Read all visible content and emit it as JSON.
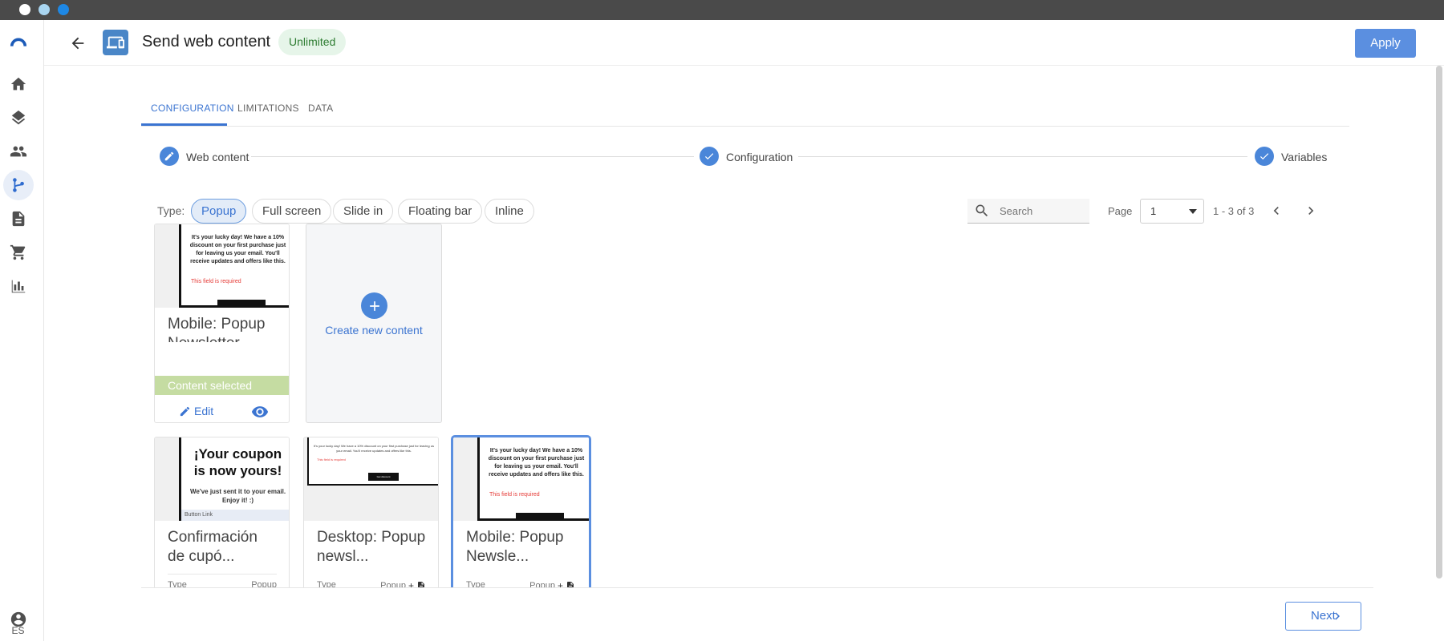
{
  "header": {
    "title": "Send web content",
    "badge": "Unlimited",
    "apply_label": "Apply"
  },
  "rail": {
    "items": [
      "logo-icon",
      "home-icon",
      "layers-icon",
      "people-icon",
      "flow-icon",
      "document-icon",
      "cart-icon",
      "bar-chart-icon"
    ],
    "active": "flow-icon",
    "language": "ES"
  },
  "tabs": [
    {
      "label": "CONFIGURATION",
      "active": true
    },
    {
      "label": "LIMITATIONS",
      "active": false
    },
    {
      "label": "DATA",
      "active": false
    }
  ],
  "stepper": [
    {
      "label": "Web content",
      "icon": "pencil-icon"
    },
    {
      "label": "Configuration",
      "icon": "check-icon"
    },
    {
      "label": "Variables",
      "icon": "check-icon"
    }
  ],
  "filters": {
    "type_label": "Type:",
    "chips": [
      "Popup",
      "Full screen",
      "Slide in",
      "Floating bar",
      "Inline"
    ],
    "active_chip": "Popup",
    "search_placeholder": "Search",
    "page_label": "Page",
    "page_value": "1",
    "range": "1 - 3 of 3"
  },
  "selected_card": {
    "title_line1": "Mobile: Popup",
    "title_line2": "Newsletter",
    "status": "Content selected",
    "edit_label": "Edit",
    "preview_text": "It's your lucky day! We have a 10% discount on your first purchase just for leaving us your email. You'll receive updates and offers like this.",
    "error_text": "This field is required"
  },
  "create_card": {
    "label": "Create new content"
  },
  "cards": [
    {
      "title_line1": "Confirmación",
      "title_line2": "de cupó...",
      "type_label": "Type",
      "type_value": "Popup",
      "preview_title": "¡Your coupon is now yours!",
      "preview_sub": "We've just sent it to your email. Enjoy it! :)",
      "preview_link": "Button Link"
    },
    {
      "title_line1": "Desktop: Popup",
      "title_line2": "newsl...",
      "type_label": "Type",
      "type_value": "Popup",
      "preview_text": "It's your lucky day! We have a 10% discount on your first purchase just for leaving us your email. You'll receive updates and offers like this.",
      "preview_error": "This field is required",
      "preview_button": "Get discount"
    },
    {
      "title_line1": "Mobile: Popup",
      "title_line2": "Newsle...",
      "type_label": "Type",
      "type_value": "Popup",
      "preview_text": "It's your lucky day! We have a 10% discount on your first purchase just for leaving us your email. You'll receive updates and offers like this.",
      "preview_error": "This field is required"
    }
  ],
  "footer": {
    "next_label": "Next"
  },
  "colors": {
    "primary": "#5b8fe0",
    "accent_text": "#3b74d1",
    "badge_bg": "#e6f5e9",
    "badge_text": "#2e7d32",
    "selected_bar": "#c5dca2"
  }
}
